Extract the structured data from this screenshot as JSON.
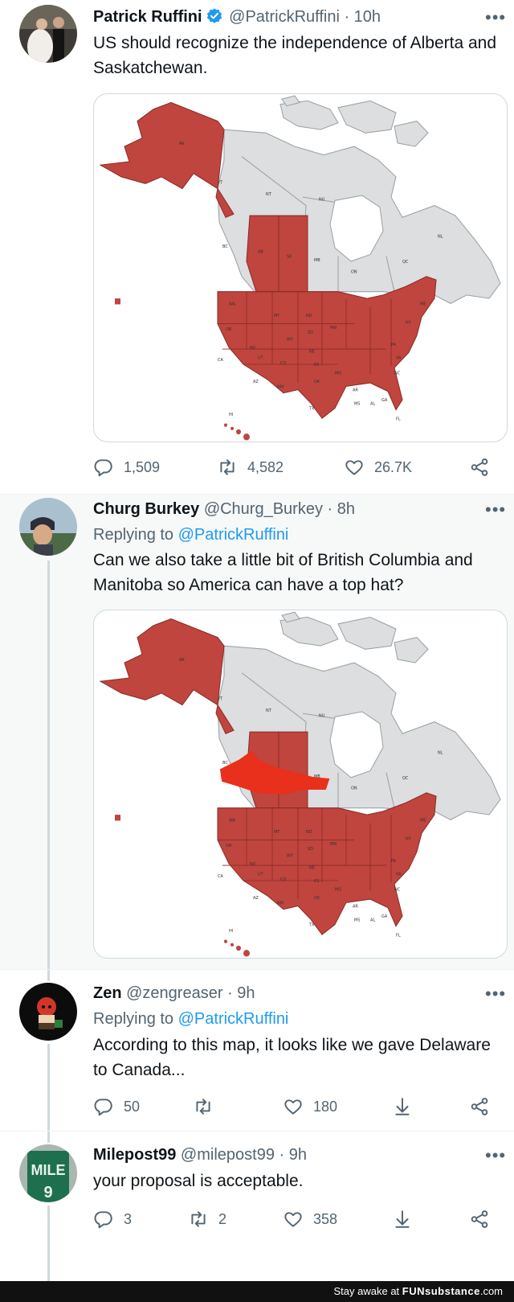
{
  "colors": {
    "accent": "#1d9bf0",
    "secondary_text": "#536471",
    "map_us": "#c0453f",
    "map_other": "#dcdedf",
    "map_scribble": "#e8301c"
  },
  "tweets": [
    {
      "name": "Patrick Ruffini",
      "verified": true,
      "handle": "@PatrickRuffini",
      "time": "· 10h",
      "text": "US should recognize the independence of Alberta and Saskatchewan.",
      "media": "map-north-america",
      "replies": "1,509",
      "retweets": "4,582",
      "likes": "26.7K"
    },
    {
      "name": "Churg Burkey",
      "handle": "@Churg_Burkey",
      "time": "· 8h",
      "replying_prefix": "Replying to",
      "replying_to": "@PatrickRuffini",
      "text": "Can we also take a little bit of British Columbia and Manitoba so America can have a top hat?",
      "media": "map-north-america-with-top-hat"
    },
    {
      "name": "Zen",
      "handle": "@zengreaser",
      "time": "· 9h",
      "replying_prefix": "Replying to",
      "replying_to": "@PatrickRuffini",
      "text": "According to this map, it looks like we gave Delaware to Canada...",
      "replies": "50",
      "retweets": "",
      "likes": "180"
    },
    {
      "name": "Milepost99",
      "handle": "@milepost99",
      "time": "· 9h",
      "text": "your proposal is acceptable.",
      "replies": "3",
      "retweets": "2",
      "likes": "358"
    }
  ],
  "more_label": "•••",
  "footer": {
    "text": "Stay awake at",
    "brand": "FUNsubstance",
    "suffix": ".com"
  }
}
